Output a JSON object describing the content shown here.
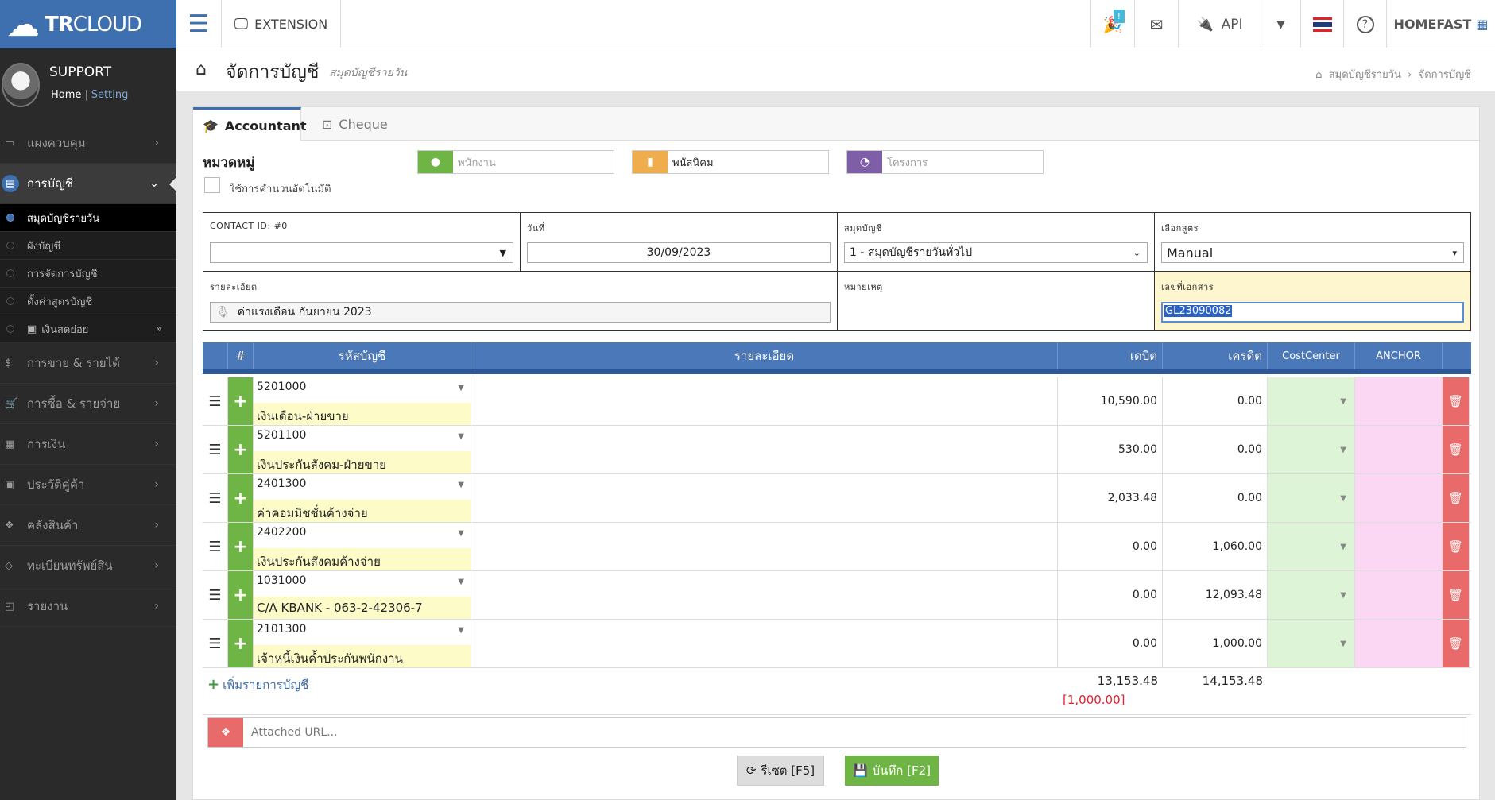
{
  "brand": {
    "bold": "TR",
    "light": "CLOUD"
  },
  "topbar": {
    "menu_icon": "hamburger-icon",
    "extension_label": "EXTENSION",
    "notification_badge": "!",
    "api_label": "API",
    "company": "HOMEFAST"
  },
  "user": {
    "name": "SUPPORT",
    "home_link": "Home",
    "separator": "|",
    "setting_link": "Setting"
  },
  "sidebar": {
    "items": [
      {
        "label": "แผงควบคุม",
        "icon": "monitor-icon"
      },
      {
        "label": "การบัญชี",
        "icon": "book-icon"
      },
      {
        "label": "การขาย & รายได้",
        "icon": "dollar-icon"
      },
      {
        "label": "การซื้อ & รายจ่าย",
        "icon": "cart-icon"
      },
      {
        "label": "การเงิน",
        "icon": "calendar-icon"
      },
      {
        "label": "ประวัติคู่ค้า",
        "icon": "contact-icon"
      },
      {
        "label": "คลังสินค้า",
        "icon": "cubes-icon"
      },
      {
        "label": "ทะเบียนทรัพย์สิน",
        "icon": "diamond-icon"
      },
      {
        "label": "รายงาน",
        "icon": "report-icon"
      }
    ],
    "submenu": [
      {
        "label": "สมุดบัญชีรายวัน"
      },
      {
        "label": "ผังบัญชี"
      },
      {
        "label": "การจัดการบัญชี"
      },
      {
        "label": "ตั้งค่าสูตรบัญชี"
      },
      {
        "label": "เงินสดย่อย"
      }
    ]
  },
  "page": {
    "title": "จัดการบัญชี",
    "subtitle": "สมุดบัญชีรายวัน",
    "breadcrumb": [
      "สมุดบัญชีรายวัน",
      "จัดการบัญชี"
    ]
  },
  "tabs": [
    {
      "label": "Accountant"
    },
    {
      "label": "Cheque"
    }
  ],
  "category": {
    "label": "หมวดหมู่",
    "auto_calc_label": "ใช้การคำนวนอัตโนมัติ",
    "employee_placeholder": "พนักงาน",
    "employee_color": "#6fb545",
    "project_placeholder": "โครงการ",
    "project_color": "#7f5ea8",
    "group_value": "พนัสนิคม",
    "group_color": "#f0ad4e"
  },
  "header_form": {
    "contact_label": "CONTACT ID: #0",
    "date_label": "วันที่",
    "date_value": "30/09/2023",
    "journal_label": "สมุดบัญชี",
    "journal_value": "1 - สมุดบัญชีรายวันทั่วไป",
    "formula_label": "เลือกสูตร",
    "formula_value": "Manual",
    "detail_label": "รายละเอียด",
    "detail_value": "ค่าแรงเดือน กันยายน 2023",
    "remark_label": "หมายเหตุ",
    "docno_label": "เลขที่เอกสาร",
    "docno_value": "GL23090082"
  },
  "grid": {
    "headers": {
      "num": "#",
      "account": "รหัสบัญชี",
      "detail": "รายละเอียด",
      "debit": "เดบิต",
      "credit": "เครดิต",
      "costcenter": "CostCenter",
      "anchor": "ANCHOR"
    },
    "rows": [
      {
        "code": "5201000",
        "name": "เงินเดือน-ฝ่ายขาย",
        "debit": "10,590.00",
        "credit": "0.00"
      },
      {
        "code": "5201100",
        "name": "เงินประกันสังคม-ฝ่ายขาย",
        "debit": "530.00",
        "credit": "0.00"
      },
      {
        "code": "2401300",
        "name": "ค่าคอมมิชชั่นค้างจ่าย",
        "debit": "2,033.48",
        "credit": "0.00"
      },
      {
        "code": "2402200",
        "name": "เงินประกันสังคมค้างจ่าย",
        "debit": "0.00",
        "credit": "1,060.00"
      },
      {
        "code": "1031000",
        "name": "C/A KBANK - 063-2-42306-7",
        "debit": "0.00",
        "credit": "12,093.48"
      },
      {
        "code": "2101300",
        "name": "เจ้าหนี้เงินค้ำประกันพนักงาน",
        "debit": "0.00",
        "credit": "1,000.00"
      }
    ],
    "add_line_label": "เพิ่มรายการบัญชี",
    "total_debit": "13,153.48",
    "total_credit": "14,153.48",
    "difference": "[1,000.00]"
  },
  "attach": {
    "placeholder": "Attached URL..."
  },
  "buttons": {
    "reset": "รีเซต [F5]",
    "save": "บันทึก [F2]"
  }
}
